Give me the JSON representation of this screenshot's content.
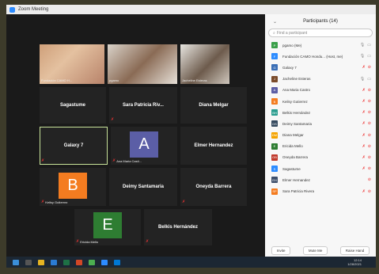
{
  "window": {
    "title": "Zoom Meeting"
  },
  "tiles": [
    {
      "key": "t1",
      "name": "Fundación CAMO H...",
      "type": "video"
    },
    {
      "key": "t2",
      "name": "pgamo",
      "type": "video"
    },
    {
      "key": "t3",
      "name": "Jacheline Esteras",
      "type": "video"
    },
    {
      "key": "t4",
      "name": "Sagastume",
      "type": "name"
    },
    {
      "key": "t5",
      "name": "Sara Patricia Riv...",
      "type": "name"
    },
    {
      "key": "t6",
      "name": "Diana Melgar",
      "type": "name"
    },
    {
      "key": "t7",
      "name": "Galaxy 7",
      "type": "name",
      "active": true
    },
    {
      "key": "t8",
      "name": "Ana Maria Casti...",
      "type": "avatar",
      "letter": "A",
      "color": "#5b5ea6"
    },
    {
      "key": "t9",
      "name": "Elmer Hernandez",
      "type": "name"
    },
    {
      "key": "t10",
      "name": "Keilsy Gutierrez",
      "type": "avatar",
      "letter": "B",
      "color": "#f47c20"
    },
    {
      "key": "t11",
      "name": "Deimy Santamaria",
      "type": "name"
    },
    {
      "key": "t12",
      "name": "Oneyda Barrera",
      "type": "name"
    },
    {
      "key": "t13",
      "name": "Ericida Mello",
      "type": "avatar",
      "letter": "E",
      "color": "#2e7d32"
    },
    {
      "key": "t14",
      "name": "Belkis Hernández",
      "type": "name"
    }
  ],
  "participants": {
    "title": "Participants (14)",
    "search_placeholder": "Find a participant",
    "items": [
      {
        "name": "pgamo (Me)",
        "letter": "P",
        "color": "#3aa04a",
        "icons": "mic,cam"
      },
      {
        "name": "Fundación CAMO Hondu... (Host, me)",
        "letter": "F",
        "color": "#2d8cff",
        "icons": "mic,cam"
      },
      {
        "name": "Galaxy 7",
        "letter": "G",
        "color": "#3b6fb6",
        "icons": "mute,cam-off"
      },
      {
        "name": "Jacheline Esteras",
        "letter": "J",
        "color": "#7a4b2a",
        "icons": "mic,cam"
      },
      {
        "name": "Ana Maria Castro",
        "letter": "A",
        "color": "#5b5ea6",
        "icons": "mute,cam-off"
      },
      {
        "name": "Keilsy Gutierrez",
        "letter": "B",
        "color": "#f47c20",
        "icons": "mute,cam-off"
      },
      {
        "name": "Belkis Hernández",
        "letter": "BH",
        "color": "#2a9d8f",
        "icons": "mute,cam-off"
      },
      {
        "name": "Deimy Santamaria",
        "letter": "DS",
        "color": "#34495e",
        "icons": "mute,cam-off"
      },
      {
        "name": "Diana Melgar",
        "letter": "DM",
        "color": "#f4a300",
        "icons": "mute,cam-off"
      },
      {
        "name": "Ericida Mello",
        "letter": "E",
        "color": "#2e7d32",
        "icons": "mute,cam-off"
      },
      {
        "name": "Oneyda Barrera",
        "letter": "OB",
        "color": "#c0392b",
        "icons": "mute,cam-off"
      },
      {
        "name": "Sagastume",
        "letter": "S",
        "color": "#2d8cff",
        "icons": "mute,cam-off"
      },
      {
        "name": "Elmer Hernandez",
        "letter": "EH",
        "color": "#3d4f6b",
        "icons": "cam-off"
      },
      {
        "name": "Sara Patricia Rivera",
        "letter": "SP",
        "color": "#f47c20",
        "icons": "mute,cam-off"
      }
    ],
    "footer": {
      "invite": "Invite",
      "mute_me": "Mute Me",
      "raise_hand": "Raise Hand"
    }
  },
  "taskbar": {
    "time": "12:14",
    "date": "1/28/2021"
  }
}
